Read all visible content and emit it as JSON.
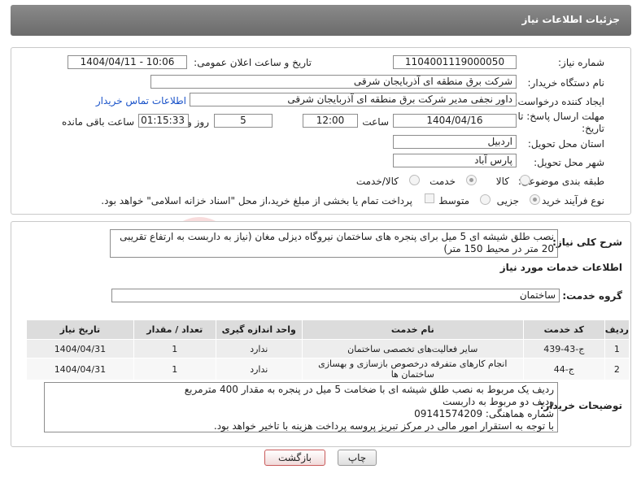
{
  "header": {
    "title": "جزئیات اطلاعات نیاز"
  },
  "form": {
    "need_number_label": "شماره نیاز:",
    "need_number": "1104001119000050",
    "announce_label": "تاریخ و ساعت اعلان عمومی:",
    "announce_value": "1404/04/11 - 10:06",
    "buyer_label": "نام دستگاه خریدار:",
    "buyer_value": "شرکت برق منطقه ای آذربایجان شرقی",
    "requester_label": "ایجاد کننده درخواست:",
    "requester_value": "داور نجفی مدیر شرکت برق منطقه ای آذربایجان شرقی",
    "contact_link": "اطلاعات تماس خریدار",
    "deadline_label": "مهلت ارسال پاسخ: تا تاریخ:",
    "deadline_date": "1404/04/16",
    "time_label": "ساعت",
    "deadline_time": "12:00",
    "days_value": "5",
    "days_label": "روز و",
    "remaining_time": "01:15:33",
    "remaining_label": "ساعت باقی مانده",
    "province_label": "استان محل تحویل:",
    "province_value": "اردبیل",
    "city_label": "شهر محل تحویل:",
    "city_value": "پارس آباد",
    "category_label": "طبقه بندی موضوعی:",
    "category_options": [
      "کالا",
      "خدمت",
      "کالا/خدمت"
    ],
    "category_selected": "خدمت",
    "process_label": "نوع فرآیند خرید :",
    "process_options": [
      "جزیی",
      "متوسط"
    ],
    "process_selected": "جزیی",
    "treasury_note": "پرداخت تمام یا بخشی از مبلغ خرید،از محل \"اسناد خزانه اسلامی\" خواهد بود."
  },
  "summary": {
    "label": "شرح کلی نیاز:",
    "text": "نصب طلق شیشه ای 5 میل برای پنجره های ساختمان نیروگاه دیزلی مغان (نیاز به داربست به ارتفاع تقریبی 20 متر در محیط 150 متر)"
  },
  "services": {
    "section_title": "اطلاعات خدمات مورد نیاز",
    "group_label": "گروه خدمت:",
    "group_value": "ساختمان",
    "columns": [
      "ردیف",
      "کد خدمت",
      "نام خدمت",
      "واحد اندازه گیری",
      "تعداد / مقدار",
      "تاریخ نیاز"
    ],
    "rows": [
      [
        "1",
        "ج-43-439",
        "سایر فعالیت‌های تخصصی ساختمان",
        "ندارد",
        "1",
        "1404/04/31"
      ],
      [
        "2",
        "ج-44",
        "انجام کارهای متفرقه درخصوص بازسازی و بهسازی ساختمان ها",
        "ندارد",
        "1",
        "1404/04/31"
      ]
    ]
  },
  "notes": {
    "label": "توضیحات خریدار:",
    "lines": [
      "ردیف یک مربوط به نصب طلق شیشه ای با  ضخامت 5 میل در پنجره به مقدار 400 مترمربع",
      "ردیف دو مربوط به داربست",
      "شماره هماهنگی: 09141574209",
      "با توجه به استقرار امور مالی در مرکز تبریز پروسه پرداخت هزینه با تاخیر خواهد بود."
    ]
  },
  "buttons": {
    "print": "چاپ",
    "back": "بازگشت"
  },
  "watermark": {
    "text": "AriaTender.neT"
  }
}
